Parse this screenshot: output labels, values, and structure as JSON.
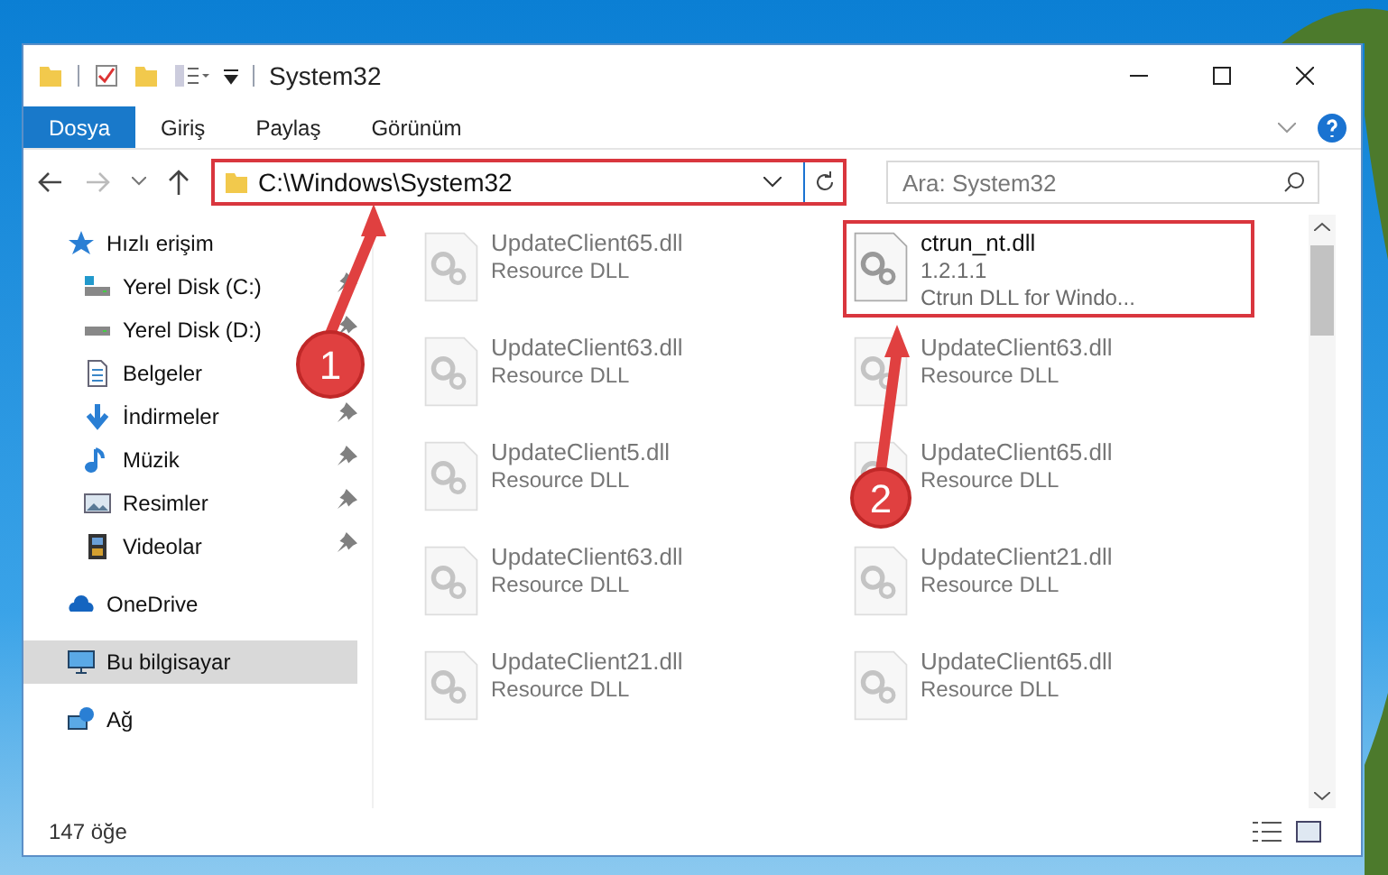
{
  "window": {
    "title": "System32"
  },
  "ribbon_tabs": [
    {
      "label": "Dosya",
      "selected": true
    },
    {
      "label": "Giriş",
      "selected": false
    },
    {
      "label": "Paylaş",
      "selected": false
    },
    {
      "label": "Görünüm",
      "selected": false
    }
  ],
  "address": {
    "value": "C:\\Windows\\System32",
    "highlighted": true
  },
  "search": {
    "placeholder": "Ara: System32"
  },
  "sidebar": {
    "items": [
      {
        "label": "Hızlı erişim",
        "selected": false,
        "children": [
          {
            "label": "Yerel Disk (C:)",
            "pinned": true,
            "selected": false
          },
          {
            "label": "Yerel Disk (D:)",
            "pinned": true,
            "selected": false
          },
          {
            "label": "Belgeler",
            "selected": false
          },
          {
            "label": "İndirmeler",
            "pinned": true,
            "selected": false
          },
          {
            "label": "Müzik",
            "pinned": true,
            "selected": false
          },
          {
            "label": "Resimler",
            "pinned": true,
            "selected": false
          },
          {
            "label": "Videolar",
            "pinned": true,
            "selected": false
          }
        ]
      },
      {
        "label": "OneDrive",
        "selected": false
      },
      {
        "label": "Bu bilgisayar",
        "selected": true
      },
      {
        "label": "Ağ",
        "selected": false
      }
    ]
  },
  "files": [
    {
      "name": "UpdateClient65.dll",
      "lines": [
        "Resource DLL"
      ],
      "dimmed": true,
      "highlighted": false
    },
    {
      "name": "ctrun_nt.dll",
      "lines": [
        "1.2.1.1",
        "Ctrun DLL for Windo..."
      ],
      "dimmed": false,
      "highlighted": true
    },
    {
      "name": "UpdateClient63.dll",
      "lines": [
        "Resource DLL"
      ],
      "dimmed": true,
      "highlighted": false
    },
    {
      "name": "UpdateClient63.dll",
      "lines": [
        "Resource DLL"
      ],
      "dimmed": true,
      "highlighted": false
    },
    {
      "name": "UpdateClient5.dll",
      "lines": [
        "Resource DLL"
      ],
      "dimmed": true,
      "highlighted": false
    },
    {
      "name": "UpdateClient65.dll",
      "lines": [
        "Resource DLL"
      ],
      "dimmed": true,
      "highlighted": false
    },
    {
      "name": "UpdateClient63.dll",
      "lines": [
        "Resource DLL"
      ],
      "dimmed": true,
      "highlighted": false
    },
    {
      "name": "UpdateClient21.dll",
      "lines": [
        "Resource DLL"
      ],
      "dimmed": true,
      "highlighted": false
    },
    {
      "name": "UpdateClient21.dll",
      "lines": [
        "Resource DLL"
      ],
      "dimmed": true,
      "highlighted": false
    },
    {
      "name": "UpdateClient65.dll",
      "lines": [
        "Resource DLL"
      ],
      "dimmed": true,
      "highlighted": false
    }
  ],
  "status_bar": {
    "count": "147 öğe"
  },
  "annotations": [
    {
      "label": "1"
    },
    {
      "label": "2"
    }
  ]
}
